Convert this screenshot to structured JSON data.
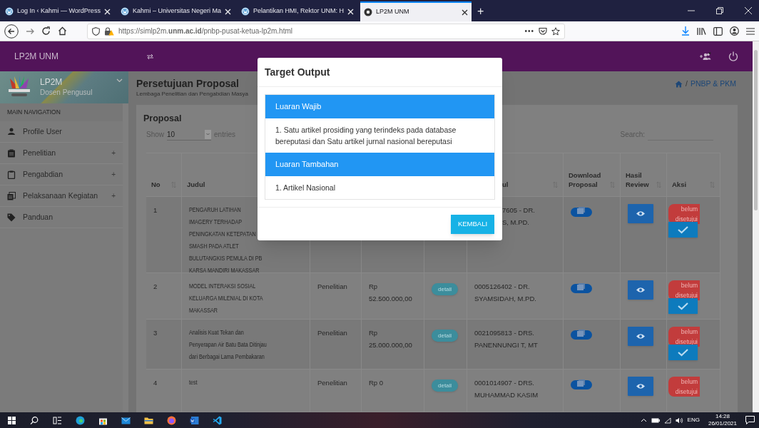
{
  "browser": {
    "tabs": [
      {
        "title": "Log In ‹ Kahmi — WordPress",
        "selected": false
      },
      {
        "title": "Kahmi – Universitas Negeri Ma",
        "selected": false
      },
      {
        "title": "Pelantikan HMI, Rektor UNM: H",
        "selected": false
      },
      {
        "title": "LP2M UNM",
        "selected": true
      }
    ],
    "new_tab": "+",
    "url": "https://simlp2m.**unm.ac.id**/pnbp-pusat-ketua-lp2m.html",
    "more": "•••"
  },
  "header": {
    "brand": "LP2M UNM"
  },
  "sidebar": {
    "user": {
      "name": "LP2M",
      "role": "Dosen Pengusul"
    },
    "section": "MAIN NAVIGATION",
    "items": [
      {
        "label": "Profile User"
      },
      {
        "label": "Penelitian",
        "toggle": "+"
      },
      {
        "label": "Pengabdian",
        "toggle": "+"
      },
      {
        "label": "Pelaksanaan Kegiatan",
        "toggle": "+"
      },
      {
        "label": "Panduan"
      }
    ]
  },
  "page": {
    "title": "Persetujuan Proposal",
    "subtitle": "Lembaga Penelitian dan Pengabdian Masya",
    "breadcrumb_separator": "/",
    "breadcrumb": "PNBP & PKM"
  },
  "card": {
    "title": "Proposal",
    "show_label": "Show",
    "page_size": "10",
    "entries_label": "entries",
    "search_label": "Search:"
  },
  "table": {
    "columns": {
      "no": {
        "label": "No",
        "sortable": true
      },
      "judul": {
        "label": "Judul"
      },
      "column_6": {
        "label": "ul",
        "sortable": true
      },
      "download": {
        "label": "Download Proposal",
        "sortable": true
      },
      "review": {
        "label": "Hasil Review",
        "sortable": true
      },
      "aksi": {
        "label": "Aksi",
        "sortable": true
      }
    },
    "rows": [
      {
        "no": "1",
        "judul": "PENGARUH LATIHAN\nIMAGERY TERHADAP\nPENINGKATAN KETEPATAN\nSMASH PADA ATLET\nBULUTANGKIS PEMULA DI PB\nKARSA MANDIRI MAKASSAR",
        "ketua": "7605 - DR.\nS, M.PD.",
        "status": "belum disetujui",
        "approve": true
      },
      {
        "no": "2",
        "judul": "MODEL INTERAKSI SOSIAL\nKELUARGA MILENIAL DI KOTA\nMAKASSAR",
        "jenis": "Penelitian",
        "dana": "Rp\n52.500.000,00",
        "detail": "detail",
        "ketua": "0005126402 - DR.\nSYAMSIDAH, M.PD.",
        "status": "belum disetujui",
        "approve": true
      },
      {
        "no": "3",
        "judul": "Analisis Kuat Tekan dan\nPenyerapan Air Batu Bata Ditinjau\ndari Berbagai Lama Pembakaran",
        "jenis": "Penelitian",
        "dana": "Rp\n25.000.000,00",
        "detail": "detail",
        "ketua": "0021095813 - DRS.\nPANENNUNGI T, MT",
        "status": "belum disetujui",
        "approve": true
      },
      {
        "no": "4",
        "judul": "test",
        "jenis": "Penelitian",
        "dana": "Rp 0",
        "detail": "detail",
        "ketua": "0001014907 - DRS.\nMUHAMMAD KASIM",
        "status": "belum disetujui",
        "approve": false
      }
    ]
  },
  "modal": {
    "title": "Target Output",
    "sections": [
      {
        "heading": "Luaran Wajib",
        "items": [
          "1. Satu artikel prosiding yang terindeks pada database bereputasi dan Satu artikel jurnal nasional bereputasi"
        ]
      },
      {
        "heading": "Luaran Tambahan",
        "items": [
          "1. Artikel Nasional"
        ]
      }
    ],
    "button": "KEMBALI"
  },
  "taskbar": {
    "language": "ENG",
    "time": "14:28",
    "date": "26/01/2021"
  }
}
